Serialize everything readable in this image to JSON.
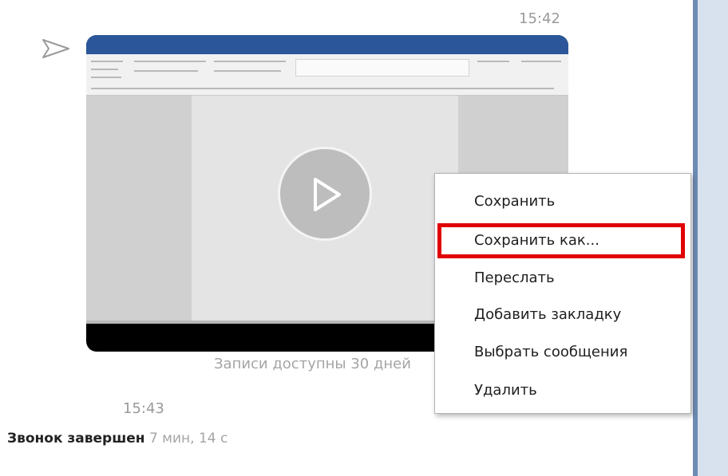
{
  "chat": {
    "time_top": "15:42",
    "time_bottom": "15:43",
    "caption": "Записи доступны 30 дней",
    "call": {
      "status": "Звонок завершен",
      "duration": "7 мин, 14 с"
    }
  },
  "video": {
    "content": "screen recording of a word processor document",
    "icon": "play-icon"
  },
  "context_menu": {
    "items": [
      {
        "label": "Сохранить"
      },
      {
        "label": "Сохранить как...",
        "highlighted": true
      },
      {
        "label": "Переслать"
      },
      {
        "label": "Добавить закладку"
      },
      {
        "label": "Выбрать сообщения"
      },
      {
        "label": "Удалить"
      }
    ],
    "highlight_color": "#e00000"
  },
  "colors": {
    "accent": "#2b579a",
    "muted_text": "#9a9a9a",
    "panel_border": "#6e8bb3"
  }
}
